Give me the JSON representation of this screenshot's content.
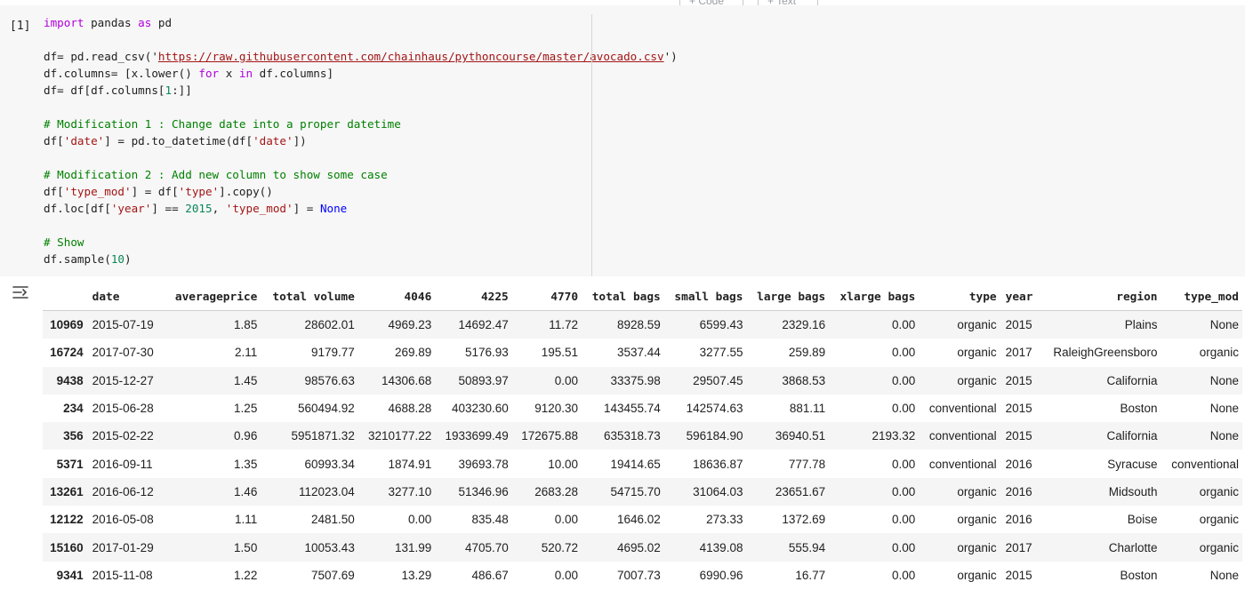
{
  "toolbar": {
    "code_label": "+ Code",
    "text_label": "+ Text"
  },
  "cell": {
    "exec_count": "[1]",
    "code_lines": [
      [
        {
          "t": "import",
          "c": "kw"
        },
        {
          "t": " pandas "
        },
        {
          "t": "as",
          "c": "kw"
        },
        {
          "t": " pd"
        }
      ],
      [],
      [
        {
          "t": "df= pd.read_csv("
        },
        {
          "t": "'"
        },
        {
          "t": "https://raw.githubusercontent.com/chainhaus/pythoncourse/master/avocado.csv",
          "c": "url"
        },
        {
          "t": "'"
        },
        {
          "t": ")"
        }
      ],
      [
        {
          "t": "df.columns= [x.lower() "
        },
        {
          "t": "for",
          "c": "kw"
        },
        {
          "t": " x "
        },
        {
          "t": "in",
          "c": "kw"
        },
        {
          "t": " df.columns]"
        }
      ],
      [
        {
          "t": "df= df[df.columns["
        },
        {
          "t": "1",
          "c": "num"
        },
        {
          "t": ":]]"
        }
      ],
      [],
      [
        {
          "t": "# Modification 1 : Change date into a proper datetime",
          "c": "cm"
        }
      ],
      [
        {
          "t": "df["
        },
        {
          "t": "'date'",
          "c": "str"
        },
        {
          "t": "] = pd.to_datetime(df["
        },
        {
          "t": "'date'",
          "c": "str"
        },
        {
          "t": "])"
        }
      ],
      [],
      [
        {
          "t": "# Modification 2 : Add new column to show some case",
          "c": "cm"
        }
      ],
      [
        {
          "t": "df["
        },
        {
          "t": "'type_mod'",
          "c": "str"
        },
        {
          "t": "] = df["
        },
        {
          "t": "'type'",
          "c": "str"
        },
        {
          "t": "].copy()"
        }
      ],
      [
        {
          "t": "df.loc[df["
        },
        {
          "t": "'year'",
          "c": "str"
        },
        {
          "t": "] == "
        },
        {
          "t": "2015",
          "c": "num"
        },
        {
          "t": ", "
        },
        {
          "t": "'type_mod'",
          "c": "str"
        },
        {
          "t": "] = "
        },
        {
          "t": "None",
          "c": "const"
        }
      ],
      [],
      [
        {
          "t": "# Show",
          "c": "cm"
        }
      ],
      [
        {
          "t": "df.sample("
        },
        {
          "t": "10",
          "c": "num"
        },
        {
          "t": ")"
        }
      ]
    ]
  },
  "output": {
    "icon": "output-toggle-icon",
    "columns": [
      "",
      "date",
      "averageprice",
      "total volume",
      "4046",
      "4225",
      "4770",
      "total bags",
      "small bags",
      "large bags",
      "xlarge bags",
      "type",
      "year",
      "region",
      "type_mod"
    ],
    "rows": [
      [
        "10969",
        "2015-07-19",
        "1.85",
        "28602.01",
        "4969.23",
        "14692.47",
        "11.72",
        "8928.59",
        "6599.43",
        "2329.16",
        "0.00",
        "organic",
        "2015",
        "Plains",
        "None"
      ],
      [
        "16724",
        "2017-07-30",
        "2.11",
        "9179.77",
        "269.89",
        "5176.93",
        "195.51",
        "3537.44",
        "3277.55",
        "259.89",
        "0.00",
        "organic",
        "2017",
        "RaleighGreensboro",
        "organic"
      ],
      [
        "9438",
        "2015-12-27",
        "1.45",
        "98576.63",
        "14306.68",
        "50893.97",
        "0.00",
        "33375.98",
        "29507.45",
        "3868.53",
        "0.00",
        "organic",
        "2015",
        "California",
        "None"
      ],
      [
        "234",
        "2015-06-28",
        "1.25",
        "560494.92",
        "4688.28",
        "403230.60",
        "9120.30",
        "143455.74",
        "142574.63",
        "881.11",
        "0.00",
        "conventional",
        "2015",
        "Boston",
        "None"
      ],
      [
        "356",
        "2015-02-22",
        "0.96",
        "5951871.32",
        "3210177.22",
        "1933699.49",
        "172675.88",
        "635318.73",
        "596184.90",
        "36940.51",
        "2193.32",
        "conventional",
        "2015",
        "California",
        "None"
      ],
      [
        "5371",
        "2016-09-11",
        "1.35",
        "60993.34",
        "1874.91",
        "39693.78",
        "10.00",
        "19414.65",
        "18636.87",
        "777.78",
        "0.00",
        "conventional",
        "2016",
        "Syracuse",
        "conventional"
      ],
      [
        "13261",
        "2016-06-12",
        "1.46",
        "112023.04",
        "3277.10",
        "51346.96",
        "2683.28",
        "54715.70",
        "31064.03",
        "23651.67",
        "0.00",
        "organic",
        "2016",
        "Midsouth",
        "organic"
      ],
      [
        "12122",
        "2016-05-08",
        "1.11",
        "2481.50",
        "0.00",
        "835.48",
        "0.00",
        "1646.02",
        "273.33",
        "1372.69",
        "0.00",
        "organic",
        "2016",
        "Boise",
        "organic"
      ],
      [
        "15160",
        "2017-01-29",
        "1.50",
        "10053.43",
        "131.99",
        "4705.70",
        "520.72",
        "4695.02",
        "4139.08",
        "555.94",
        "0.00",
        "organic",
        "2017",
        "Charlotte",
        "organic"
      ],
      [
        "9341",
        "2015-11-08",
        "1.22",
        "7507.69",
        "13.29",
        "486.67",
        "0.00",
        "7007.73",
        "6990.96",
        "16.77",
        "0.00",
        "organic",
        "2015",
        "Boston",
        "None"
      ]
    ]
  }
}
